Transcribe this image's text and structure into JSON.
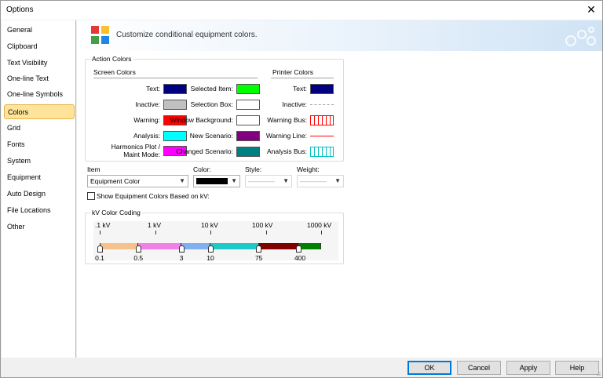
{
  "window": {
    "title": "Options",
    "close_glyph": "✕"
  },
  "sidebar": {
    "items": [
      {
        "label": "General"
      },
      {
        "label": "Clipboard"
      },
      {
        "label": "Text Visibility"
      },
      {
        "label": "One-line Text"
      },
      {
        "label": "One-line Symbols"
      },
      {
        "label": "Colors",
        "selected": true
      },
      {
        "label": "Grid"
      },
      {
        "label": "Fonts"
      },
      {
        "label": "System"
      },
      {
        "label": "Equipment"
      },
      {
        "label": "Auto Design"
      },
      {
        "label": "File Locations"
      },
      {
        "label": "Other"
      }
    ]
  },
  "banner": {
    "message": "Customize conditional equipment colors.",
    "icon": "palette-icon"
  },
  "action_colors": {
    "legend": "Action Colors",
    "screen_header": "Screen Colors",
    "printer_header": "Printer Colors",
    "screen_left": [
      {
        "label": "Text:",
        "color": "#000080"
      },
      {
        "label": "Inactive:",
        "color": "#c0c0c0"
      },
      {
        "label": "Warning:",
        "color": "#ff0000"
      },
      {
        "label": "Analysis:",
        "color": "#00ffff"
      },
      {
        "label_line1": "Harmonics Plot /",
        "label_line2": "Maint Mode:",
        "color": "#ff00ff"
      }
    ],
    "screen_right": [
      {
        "label": "Selected Item:",
        "color": "#00ff00"
      },
      {
        "label": "Selection Box:",
        "color": "#ffffff"
      },
      {
        "label": "Window Background:",
        "color": "#ffffff"
      },
      {
        "label": "New Scenario:",
        "color": "#800080"
      },
      {
        "label": "Changed Scenario:",
        "color": "#008080"
      }
    ],
    "printer": [
      {
        "label": "Text:",
        "style": "solid",
        "color": "#000080"
      },
      {
        "label": "Inactive:",
        "style": "dashed-line",
        "color": "#a0a0a0"
      },
      {
        "label": "Warning Bus:",
        "style": "hatched",
        "color": "#ff0000"
      },
      {
        "label": "Warning Line:",
        "style": "line",
        "color": "#ff0000"
      },
      {
        "label": "Analysis Bus:",
        "style": "hatched",
        "color": "#00c0c0"
      }
    ]
  },
  "item_selector": {
    "item_label": "Item",
    "item_value": "Equipment Color",
    "color_label": "Color:",
    "color_value": "#000000",
    "style_label": "Style:",
    "style_value": "————",
    "weight_label": "Weight:",
    "weight_value": "————"
  },
  "show_equipment_colors": {
    "label": "Show Equipment Colors Based on kV:",
    "checked": false
  },
  "kv_coding": {
    "legend": "kV Color Coding",
    "scale_labels": [
      ".1 kV",
      "1 kV",
      "10 kV",
      "100 kV",
      "1000 kV"
    ],
    "segments": [
      {
        "color": "#f4c28a",
        "from": 0.1,
        "to": 0.5
      },
      {
        "color": "#f080e8",
        "from": 0.5,
        "to": 3
      },
      {
        "color": "#80b0f0",
        "from": 3,
        "to": 10
      },
      {
        "color": "#20c8c8",
        "from": 10,
        "to": 75
      },
      {
        "color": "#800000",
        "from": 75,
        "to": 400
      },
      {
        "color": "#008000",
        "from": 400,
        "to": 1000
      }
    ],
    "markers": [
      "0.1",
      "0.5",
      "3",
      "10",
      "75",
      "400"
    ]
  },
  "footer": {
    "ok": "OK",
    "cancel": "Cancel",
    "apply": "Apply",
    "help": "Help"
  }
}
